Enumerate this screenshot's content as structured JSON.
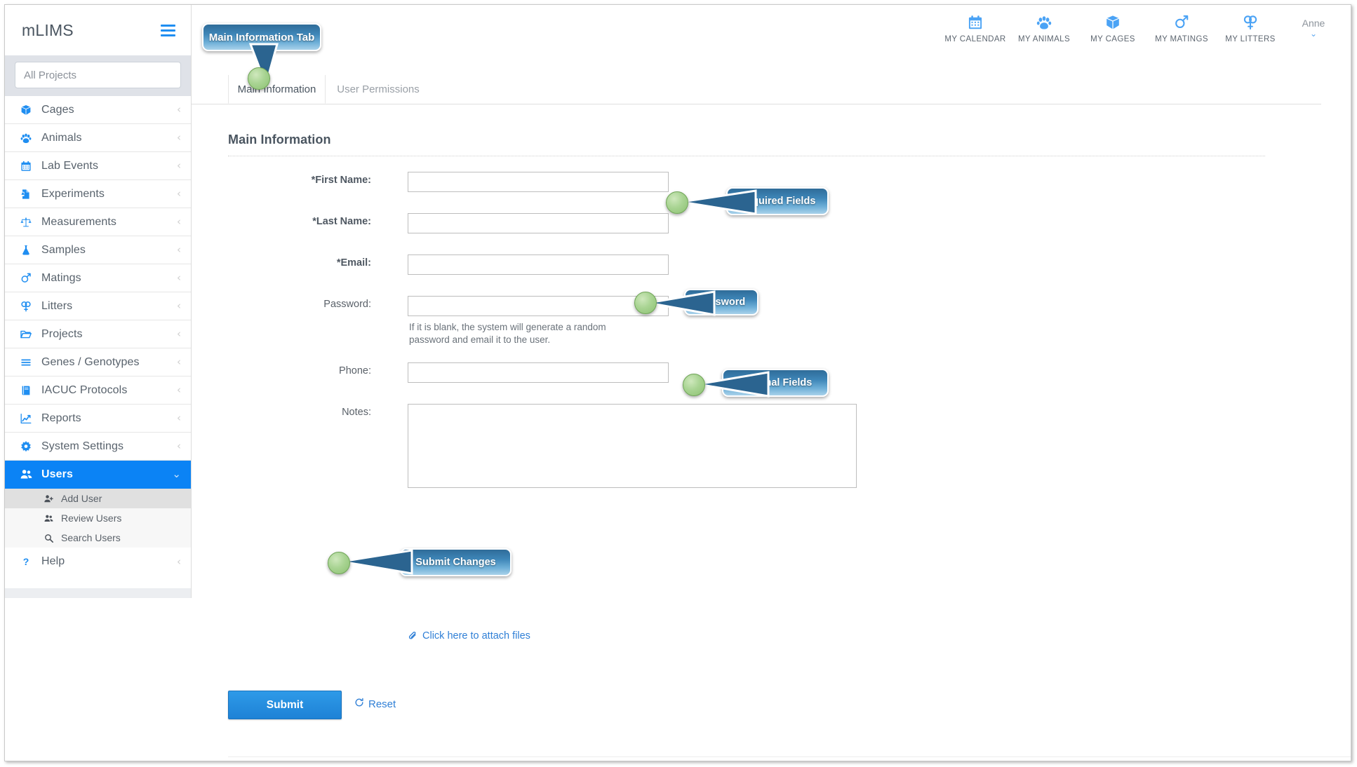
{
  "app": {
    "brand": "mLIMS",
    "menu_icon": "hamburger-icon"
  },
  "sidebar": {
    "project_filter_placeholder": "All Projects",
    "project_filter_value": "",
    "items": [
      {
        "label": "Cages",
        "icon": "box-icon",
        "chevron": "‹"
      },
      {
        "label": "Animals",
        "icon": "paw-icon",
        "chevron": "‹"
      },
      {
        "label": "Lab Events",
        "icon": "calendar-icon",
        "chevron": "‹"
      },
      {
        "label": "Experiments",
        "icon": "flask-doc-icon",
        "chevron": "‹"
      },
      {
        "label": "Measurements",
        "icon": "scale-icon",
        "chevron": "‹"
      },
      {
        "label": "Samples",
        "icon": "flask-icon",
        "chevron": "‹"
      },
      {
        "label": "Matings",
        "icon": "mars-venus-icon",
        "chevron": "‹"
      },
      {
        "label": "Litters",
        "icon": "double-venus-icon",
        "chevron": "‹"
      },
      {
        "label": "Projects",
        "icon": "folder-open-icon",
        "chevron": "‹"
      },
      {
        "label": "Genes / Genotypes",
        "icon": "bars-icon",
        "chevron": "‹"
      },
      {
        "label": "IACUC Protocols",
        "icon": "book-icon",
        "chevron": "‹"
      },
      {
        "label": "Reports",
        "icon": "chart-line-icon",
        "chevron": "‹"
      },
      {
        "label": "System Settings",
        "icon": "gear-icon",
        "chevron": "‹"
      }
    ],
    "users": {
      "label": "Users",
      "icon": "users-icon",
      "chevron": "⌄",
      "expanded": true,
      "sub_items": [
        {
          "label": "Add User",
          "icon": "user-plus-icon",
          "selected": true
        },
        {
          "label": "Review Users",
          "icon": "users-icon",
          "selected": false
        },
        {
          "label": "Search Users",
          "icon": "search-icon",
          "selected": false
        }
      ]
    },
    "help": {
      "label": "Help",
      "icon": "question-icon",
      "chevron": "‹"
    },
    "active_item": "Users"
  },
  "topnav": {
    "items": [
      {
        "label": "MY CALENDAR",
        "icon": "calendar-icon"
      },
      {
        "label": "MY ANIMALS",
        "icon": "paw-icon"
      },
      {
        "label": "MY CAGES",
        "icon": "box-icon"
      },
      {
        "label": "MY MATINGS",
        "icon": "mars-venus-icon"
      },
      {
        "label": "MY LITTERS",
        "icon": "double-venus-icon"
      }
    ],
    "user": {
      "name": "Anne",
      "caret": "⌄"
    }
  },
  "tabs": [
    {
      "label": "Main Information",
      "active": true
    },
    {
      "label": "User Permissions",
      "active": false
    }
  ],
  "form": {
    "section_title": "Main Information",
    "fields": [
      {
        "label": "*First Name:",
        "required": true,
        "type": "text",
        "value": "",
        "placeholder": ""
      },
      {
        "label": "*Last Name:",
        "required": true,
        "type": "text",
        "value": "",
        "placeholder": ""
      },
      {
        "label": "*Email:",
        "required": true,
        "type": "text",
        "value": "",
        "placeholder": ""
      },
      {
        "label": "Password:",
        "required": false,
        "type": "password",
        "value": "",
        "placeholder": ""
      },
      {
        "label": "Phone:",
        "required": false,
        "type": "text",
        "value": "",
        "placeholder": ""
      },
      {
        "label": "Notes:",
        "required": false,
        "type": "textarea",
        "value": "",
        "placeholder": ""
      }
    ],
    "password_hint": "If it is blank, the system will generate a random password and email it to the user.",
    "attach_link": "Click here to attach files",
    "attach_icon": "paperclip-icon",
    "submit_label": "Submit",
    "reset_label": "Reset",
    "reset_icon": "refresh-icon"
  },
  "callouts": [
    {
      "id": "main-information-tab",
      "text": "Main Information Tab"
    },
    {
      "id": "required-fields",
      "text": "Required Fields"
    },
    {
      "id": "password",
      "text": "Password"
    },
    {
      "id": "optional-fields",
      "text": "Optional Fields"
    },
    {
      "id": "submit-changes",
      "text": "Submit Changes"
    }
  ],
  "colors": {
    "accent_blue": "#1f8ef1",
    "active_nav": "#0b83f5",
    "link_blue": "#2f7fd6",
    "callout_blue": "#3e86b8",
    "callout_dot_green": "#a9d493",
    "submit_blue": "#1e82d6"
  }
}
